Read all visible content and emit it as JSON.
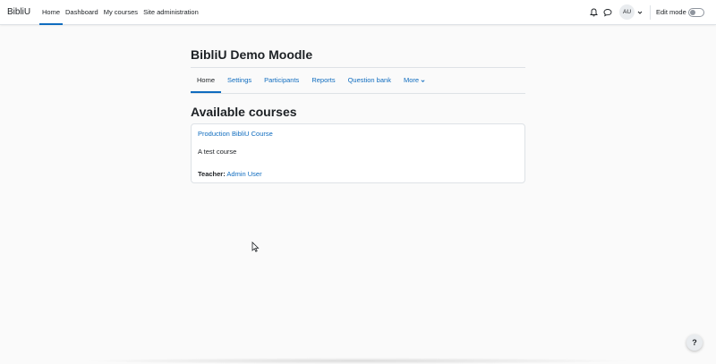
{
  "navbar": {
    "brand": "BibliU",
    "items": [
      {
        "label": "Home",
        "active": true
      },
      {
        "label": "Dashboard",
        "active": false
      },
      {
        "label": "My courses",
        "active": false
      },
      {
        "label": "Site administration",
        "active": false
      }
    ],
    "user_initials": "AU",
    "edit_mode_label": "Edit mode",
    "edit_mode_on": false
  },
  "page": {
    "title": "BibliU Demo Moodle",
    "tabs": [
      {
        "label": "Home",
        "active": true
      },
      {
        "label": "Settings",
        "active": false
      },
      {
        "label": "Participants",
        "active": false
      },
      {
        "label": "Reports",
        "active": false
      },
      {
        "label": "Question bank",
        "active": false
      },
      {
        "label": "More",
        "active": false
      }
    ]
  },
  "courses": {
    "heading": "Available courses",
    "items": [
      {
        "name": "Production BibliU Course",
        "summary": "A test course",
        "teacher_label": "Teacher:",
        "teacher_name": "Admin User"
      }
    ]
  },
  "help": {
    "label": "?"
  },
  "colors": {
    "accent": "#0f6cbf",
    "text": "#1d2125",
    "background": "#fafafa"
  }
}
